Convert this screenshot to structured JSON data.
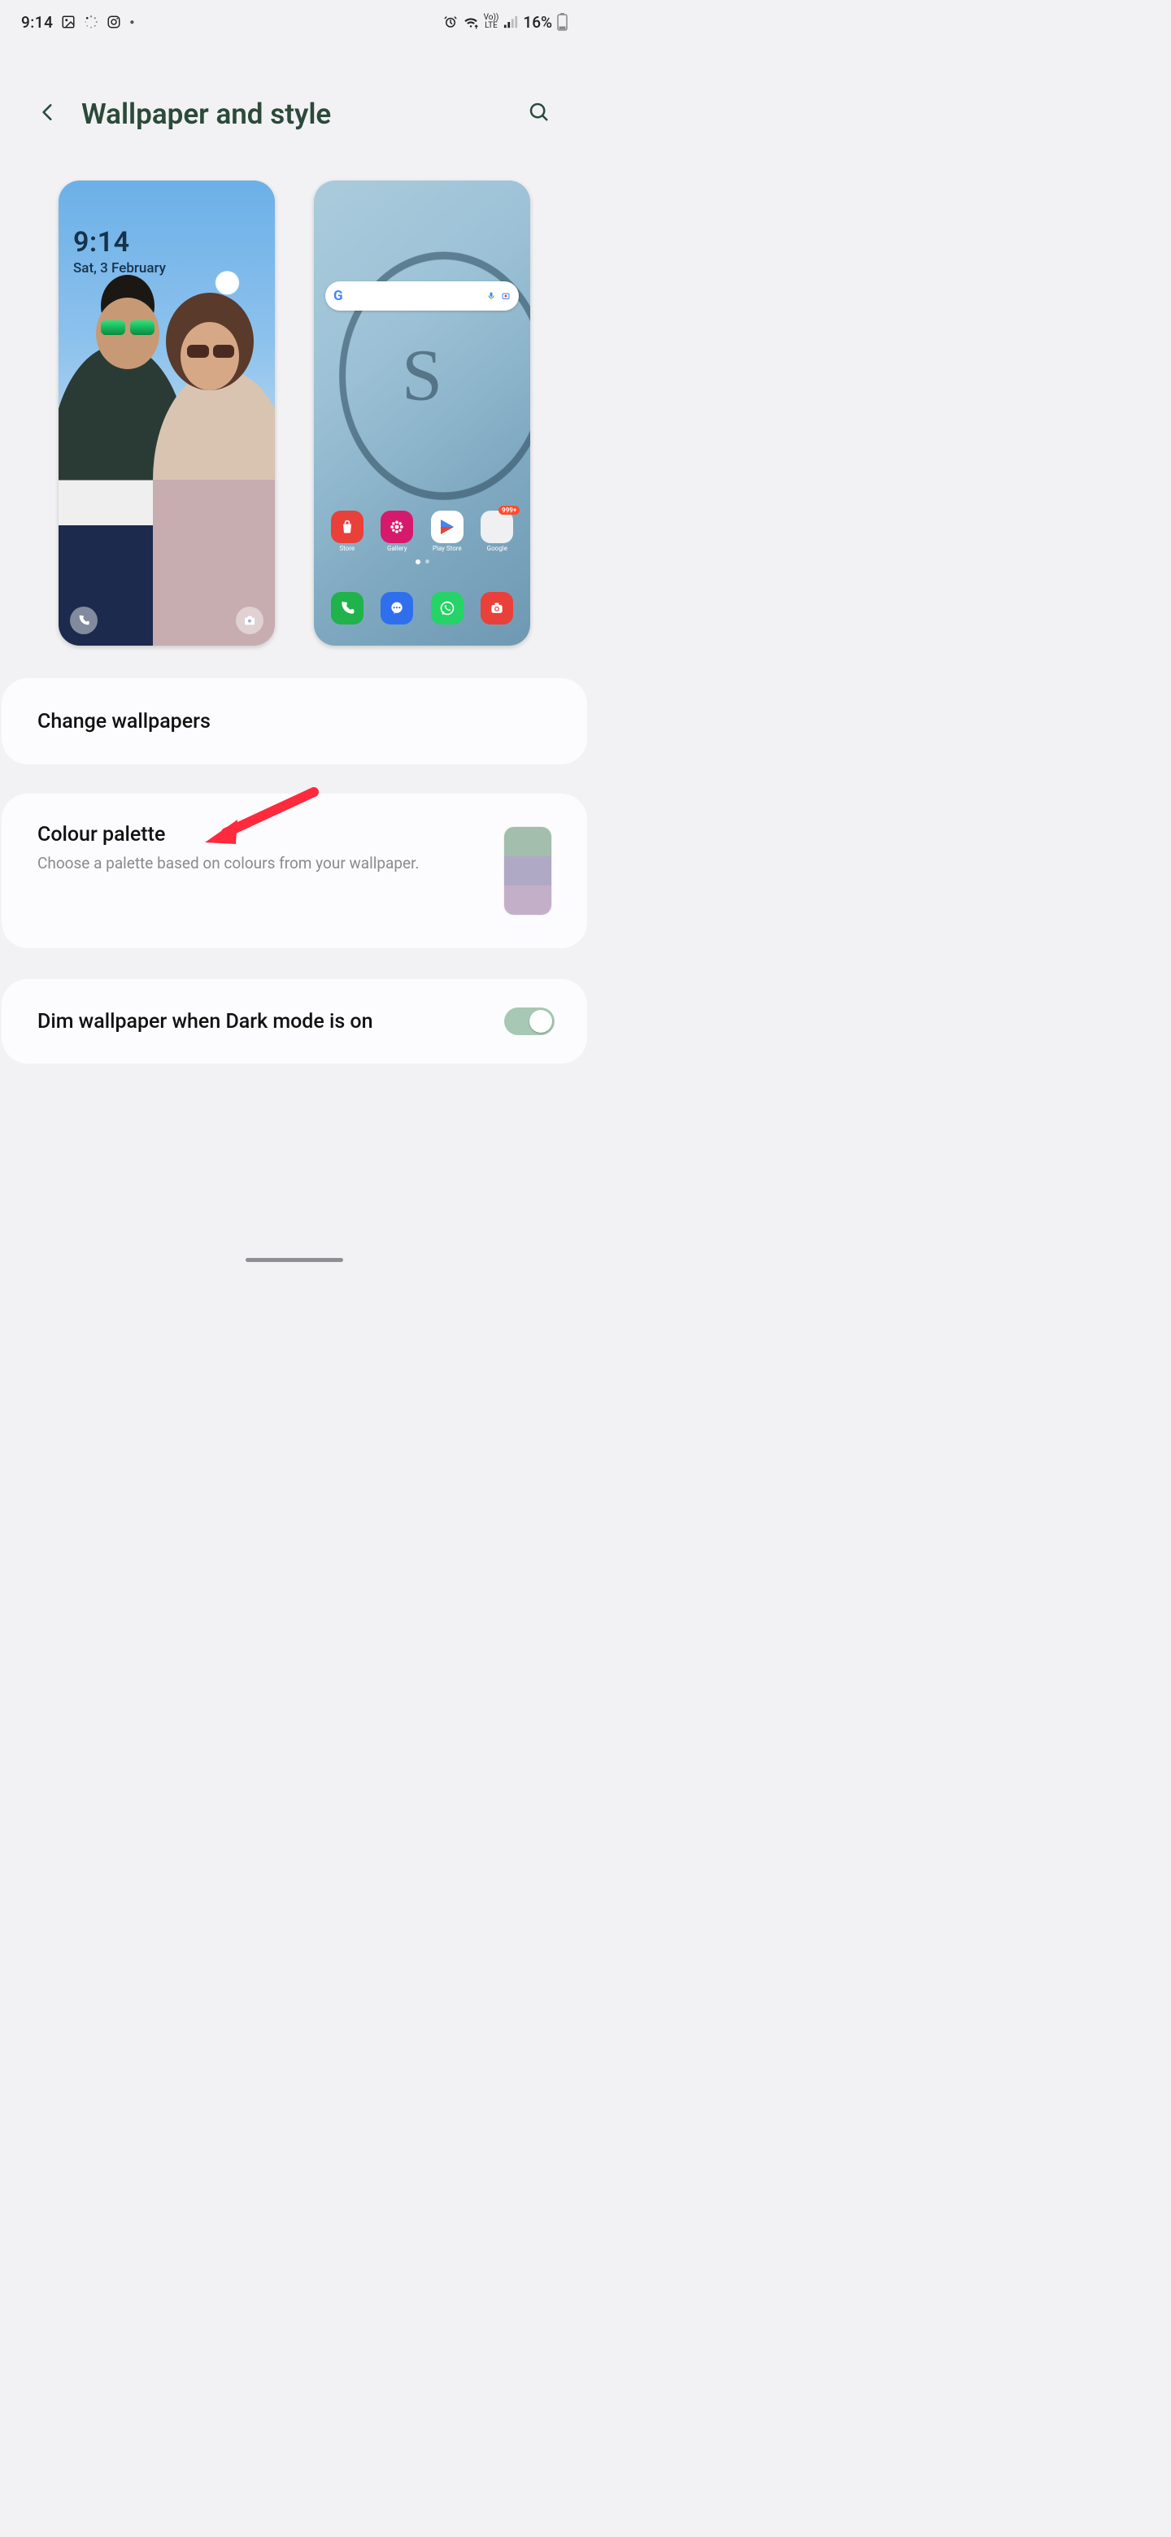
{
  "status": {
    "clock": "9:14",
    "battery_pct": "16%",
    "network_label_top": "Vo))",
    "network_label_bot": "LTE"
  },
  "header": {
    "title": "Wallpaper and style"
  },
  "lock_preview": {
    "time": "9:14",
    "date": "Sat, 3 February"
  },
  "home_preview": {
    "apps_row1": [
      {
        "name": "Store"
      },
      {
        "name": "Gallery"
      },
      {
        "name": "Play Store"
      },
      {
        "name": "Google",
        "badge": "999+"
      }
    ]
  },
  "items": {
    "change": {
      "title": "Change wallpapers"
    },
    "palette": {
      "title": "Colour palette",
      "subtitle": "Choose a palette based on colours from your wallpaper."
    },
    "dim": {
      "title": "Dim wallpaper when Dark mode is on",
      "enabled": true
    }
  }
}
